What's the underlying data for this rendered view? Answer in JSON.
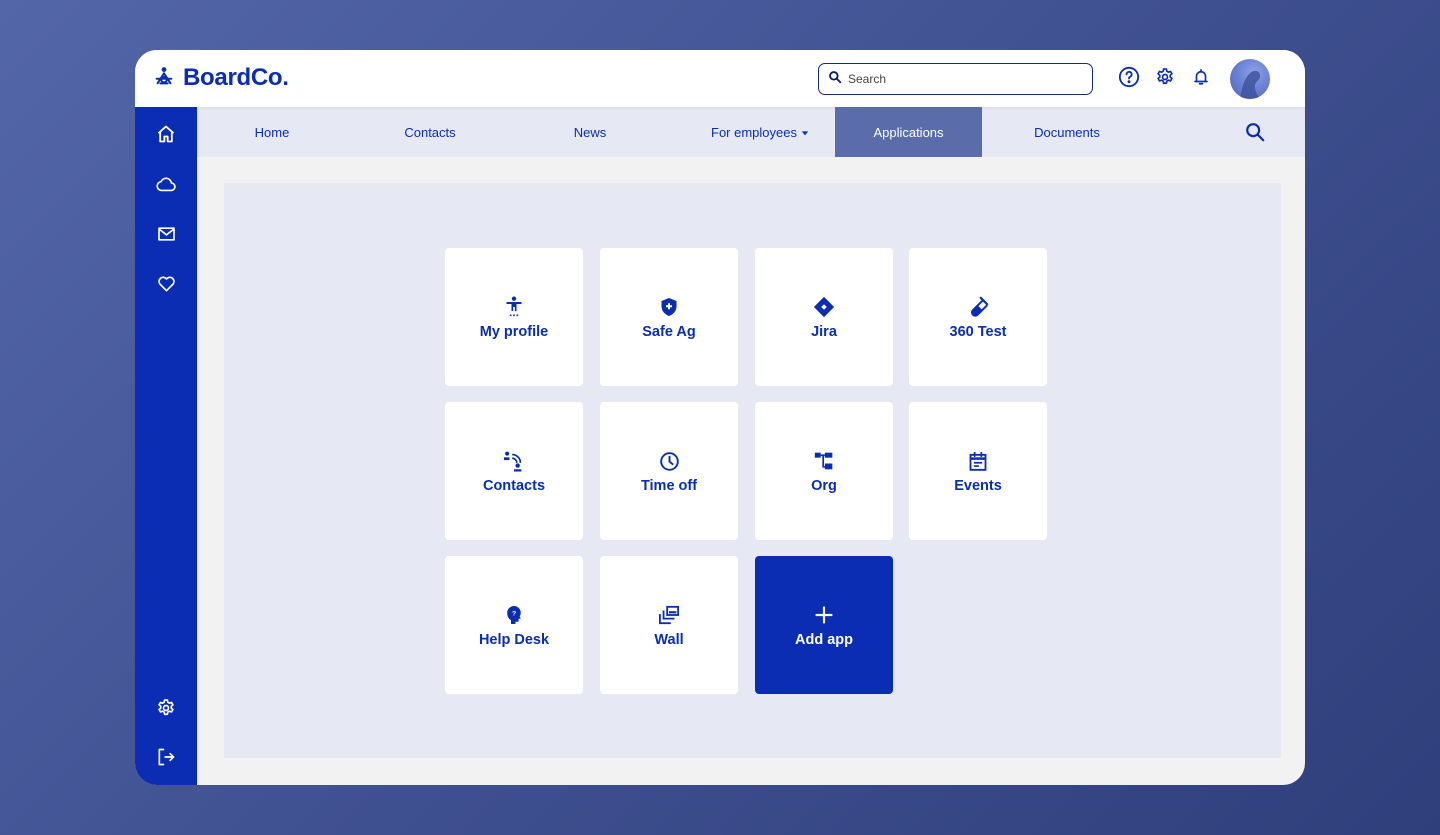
{
  "brand": {
    "name": "BoardCo.",
    "accent": "#0a2db4",
    "active_tab_color": "#5a6daa"
  },
  "header": {
    "search_placeholder": "Search",
    "icons": [
      "help-icon",
      "settings-icon",
      "bell-icon"
    ],
    "avatar": "user-avatar"
  },
  "sidebar": {
    "top_items": [
      {
        "name": "home",
        "icon": "home-icon"
      },
      {
        "name": "cloud",
        "icon": "cloud-icon"
      },
      {
        "name": "mail",
        "icon": "mail-icon"
      },
      {
        "name": "favorites",
        "icon": "heart-icon"
      }
    ],
    "bottom_items": [
      {
        "name": "settings",
        "icon": "gear-icon"
      },
      {
        "name": "logout",
        "icon": "logout-icon"
      }
    ]
  },
  "nav": {
    "tabs": [
      {
        "label": "Home"
      },
      {
        "label": "Contacts"
      },
      {
        "label": "News"
      },
      {
        "label": "For employees",
        "dropdown": true
      },
      {
        "label": "Applications",
        "active": true
      },
      {
        "label": "Documents"
      }
    ]
  },
  "apps": {
    "tiles": [
      {
        "label": "My profile",
        "icon": "accessibility-person-icon"
      },
      {
        "label": "Safe Ag",
        "icon": "shield-plus-icon"
      },
      {
        "label": "Jira",
        "icon": "diamond-icon"
      },
      {
        "label": "360 Test",
        "icon": "test-tube-icon"
      },
      {
        "label": "Contacts",
        "icon": "contacts-signal-icon"
      },
      {
        "label": "Time off",
        "icon": "clock-icon"
      },
      {
        "label": "Org",
        "icon": "org-chart-icon"
      },
      {
        "label": "Events",
        "icon": "calendar-icon"
      },
      {
        "label": "Help Desk",
        "icon": "help-head-icon"
      },
      {
        "label": "Wall",
        "icon": "gallery-stack-icon"
      }
    ],
    "add_label": "Add app"
  }
}
